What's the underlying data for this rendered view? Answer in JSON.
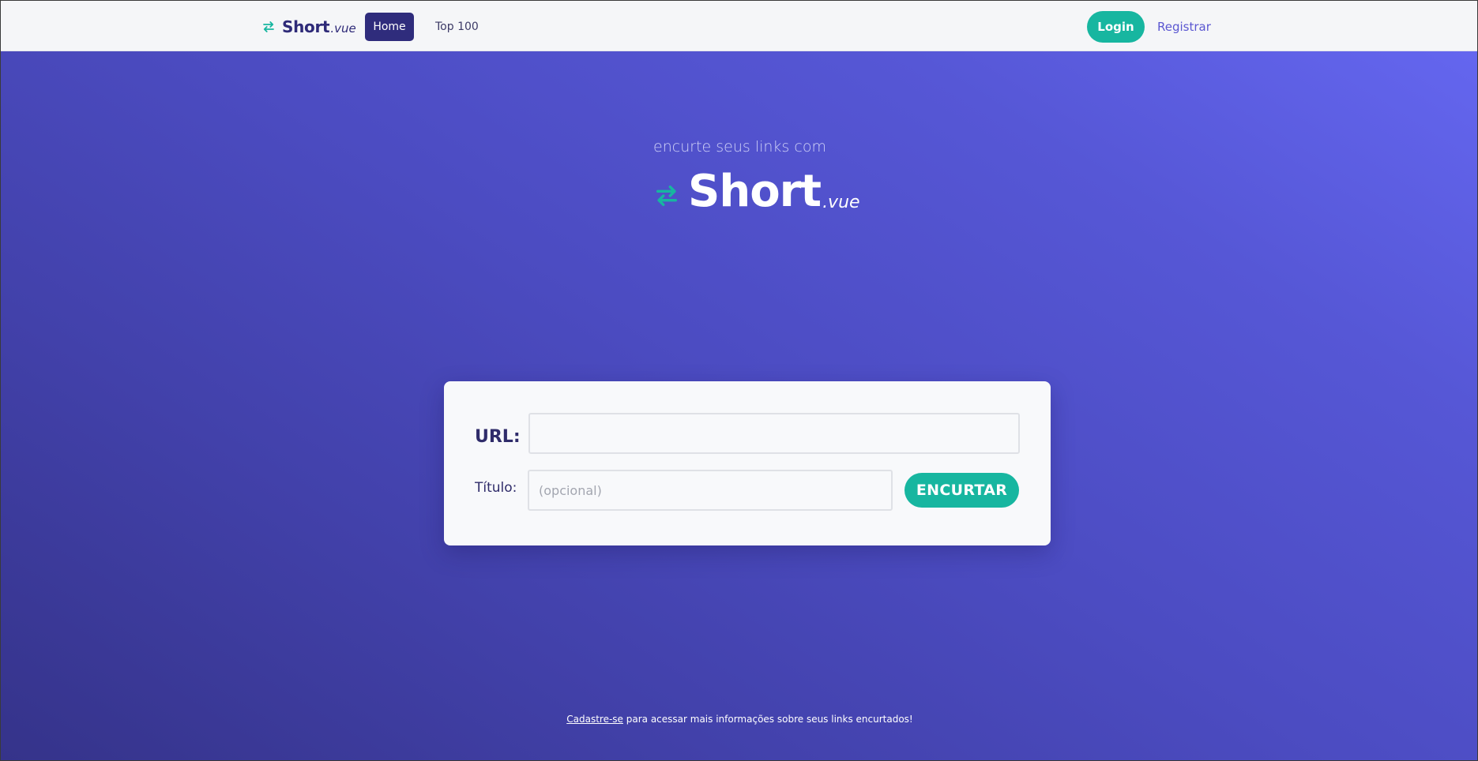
{
  "navbar": {
    "brand_name": "Short",
    "brand_suffix": ".vue",
    "links": [
      {
        "label": "Home",
        "active": true
      },
      {
        "label": "Top 100",
        "active": false
      }
    ],
    "login_label": "Login",
    "register_label": "Registrar"
  },
  "hero": {
    "tagline": "encurte seus links com",
    "logo_name": "Short",
    "logo_suffix": ".vue"
  },
  "form": {
    "url_label": "URL:",
    "url_value": "",
    "title_label": "Título:",
    "title_placeholder": "(opcional)",
    "submit_label": "ENCURTAR"
  },
  "footer": {
    "signup_link": "Cadastre-se",
    "signup_text": " para acessar mais informações sobre seus links encurtados!"
  },
  "colors": {
    "brand_dark": "#2f2c7c",
    "accent_teal": "#17b6a0",
    "register_link": "#5b57d1",
    "gradient_top": "#6466ef",
    "gradient_bottom": "#35338a"
  },
  "icons": {
    "brand_icon": "swap-arrows-icon",
    "hero_icon": "swap-arrows-icon"
  }
}
